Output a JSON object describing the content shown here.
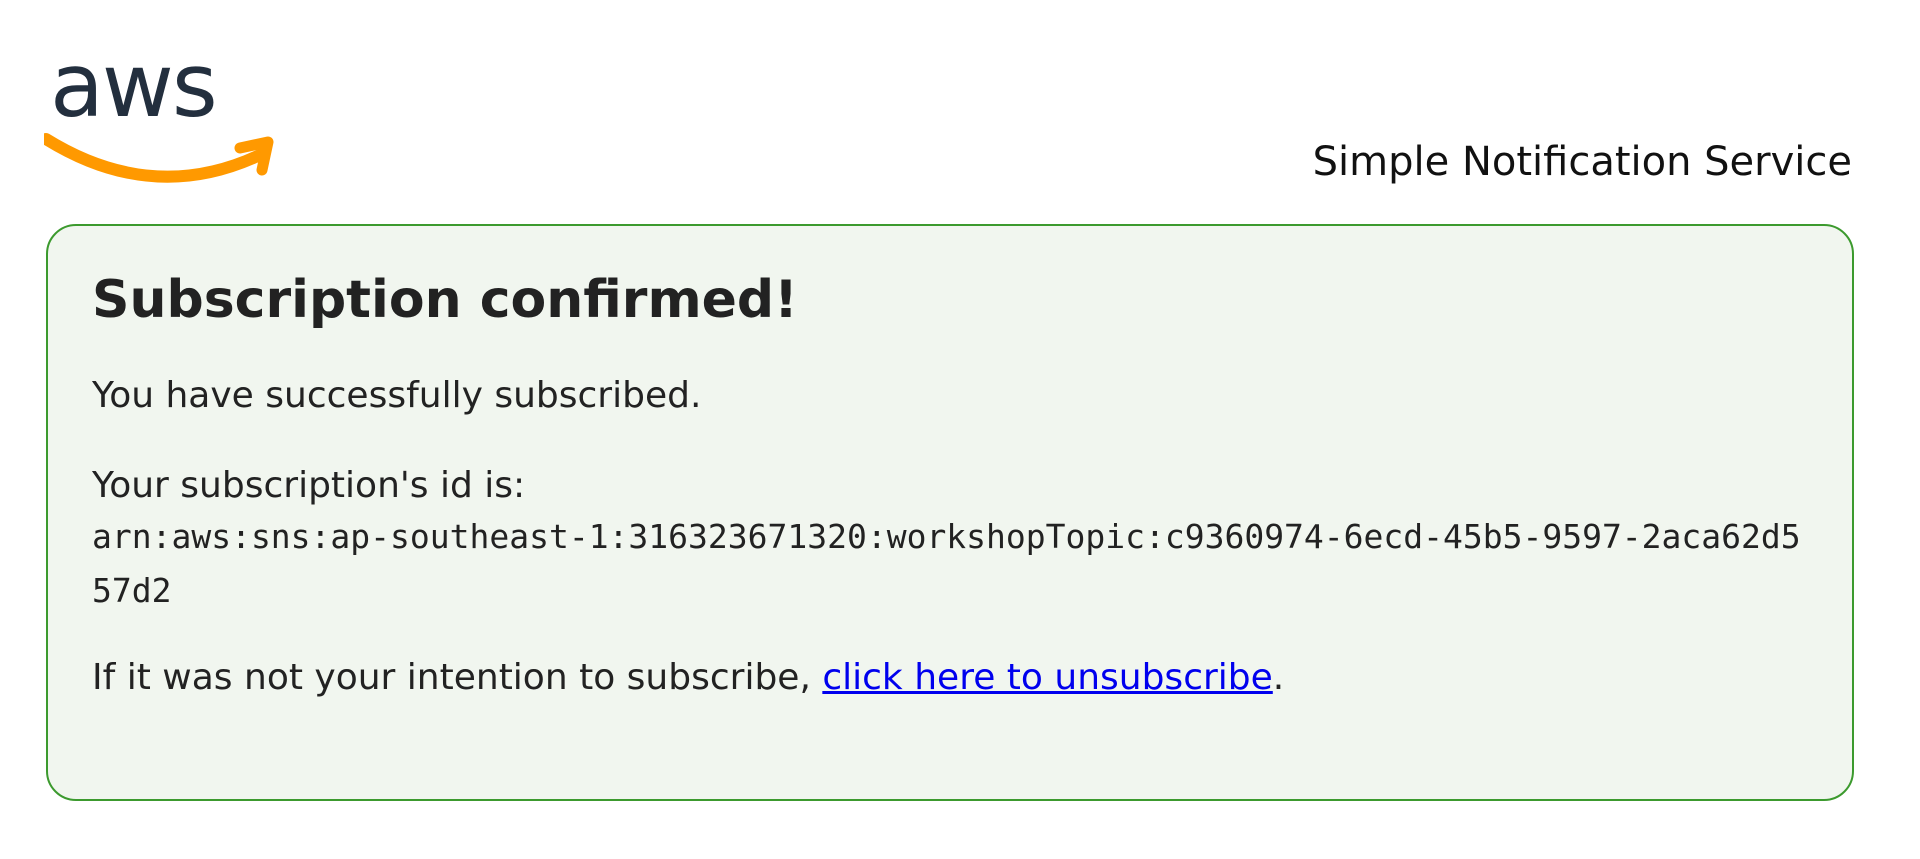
{
  "header": {
    "logo_text": "aws",
    "service_name": "Simple Notification Service"
  },
  "confirmation": {
    "title": "Subscription confirmed!",
    "success_message": "You have successfully subscribed.",
    "id_label": "Your subscription's id is:",
    "subscription_arn": "arn:aws:sns:ap-southeast-1:316323671320:workshopTopic:c9360974-6ecd-45b5-9597-2aca62d557d2",
    "unsubscribe_prefix": "If it was not your intention to subscribe, ",
    "unsubscribe_link": "click here to unsubscribe",
    "unsubscribe_suffix": "."
  },
  "colors": {
    "box_border": "#3c9a2e",
    "box_background": "#f1f6ef",
    "aws_text": "#232f3e",
    "aws_smile": "#ff9900",
    "link": "#0000ee"
  }
}
